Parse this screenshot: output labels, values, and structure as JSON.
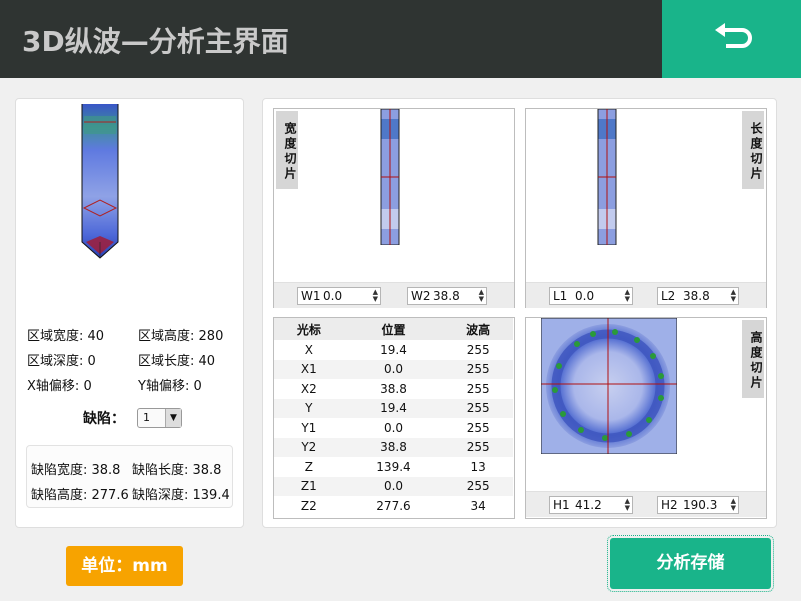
{
  "header": {
    "title": "3D纵波—分析主界面",
    "back_icon": "undo-arrow-icon"
  },
  "colors": {
    "header_bg": "#2f3432",
    "accent": "#19b48a",
    "unit_badge": "#f7a300"
  },
  "left_panel": {
    "region": {
      "width_label": "区域宽度:",
      "width_value": "40",
      "height_label": "区域高度:",
      "height_value": "280",
      "depth_label": "区域深度:",
      "depth_value": "0",
      "length_label": "区域长度:",
      "length_value": "40",
      "x_offset_label": "X轴偏移:",
      "x_offset_value": "0",
      "y_offset_label": "Y轴偏移:",
      "y_offset_value": "0"
    },
    "defect_label": "缺陷：",
    "defect_selected": "1",
    "defect_info": {
      "width": "缺陷宽度: 38.8",
      "length": "缺陷长度: 38.8",
      "height": "缺陷高度: 277.6",
      "depth": "缺陷深度: 139.4"
    }
  },
  "slices": {
    "width_slice": {
      "label": "宽度切片",
      "w1_label": "W1",
      "w1_value": "0.0",
      "w2_label": "W2",
      "w2_value": "38.8"
    },
    "length_slice": {
      "label": "长度切片",
      "l1_label": "L1",
      "l1_value": "0.0",
      "l2_label": "L2",
      "l2_value": "38.8"
    },
    "height_slice": {
      "label": "高度切片",
      "h1_label": "H1",
      "h1_value": "41.2",
      "h2_label": "H2",
      "h2_value": "190.3"
    }
  },
  "cursor_table": {
    "headers": [
      "光标",
      "位置",
      "波高"
    ],
    "rows": [
      [
        "X",
        "19.4",
        "255"
      ],
      [
        "X1",
        "0.0",
        "255"
      ],
      [
        "X2",
        "38.8",
        "255"
      ],
      [
        "Y",
        "19.4",
        "255"
      ],
      [
        "Y1",
        "0.0",
        "255"
      ],
      [
        "Y2",
        "38.8",
        "255"
      ],
      [
        "Z",
        "139.4",
        "13"
      ],
      [
        "Z1",
        "0.0",
        "255"
      ],
      [
        "Z2",
        "277.6",
        "34"
      ]
    ]
  },
  "footer": {
    "unit": "单位：mm",
    "save_label": "分析存储"
  }
}
